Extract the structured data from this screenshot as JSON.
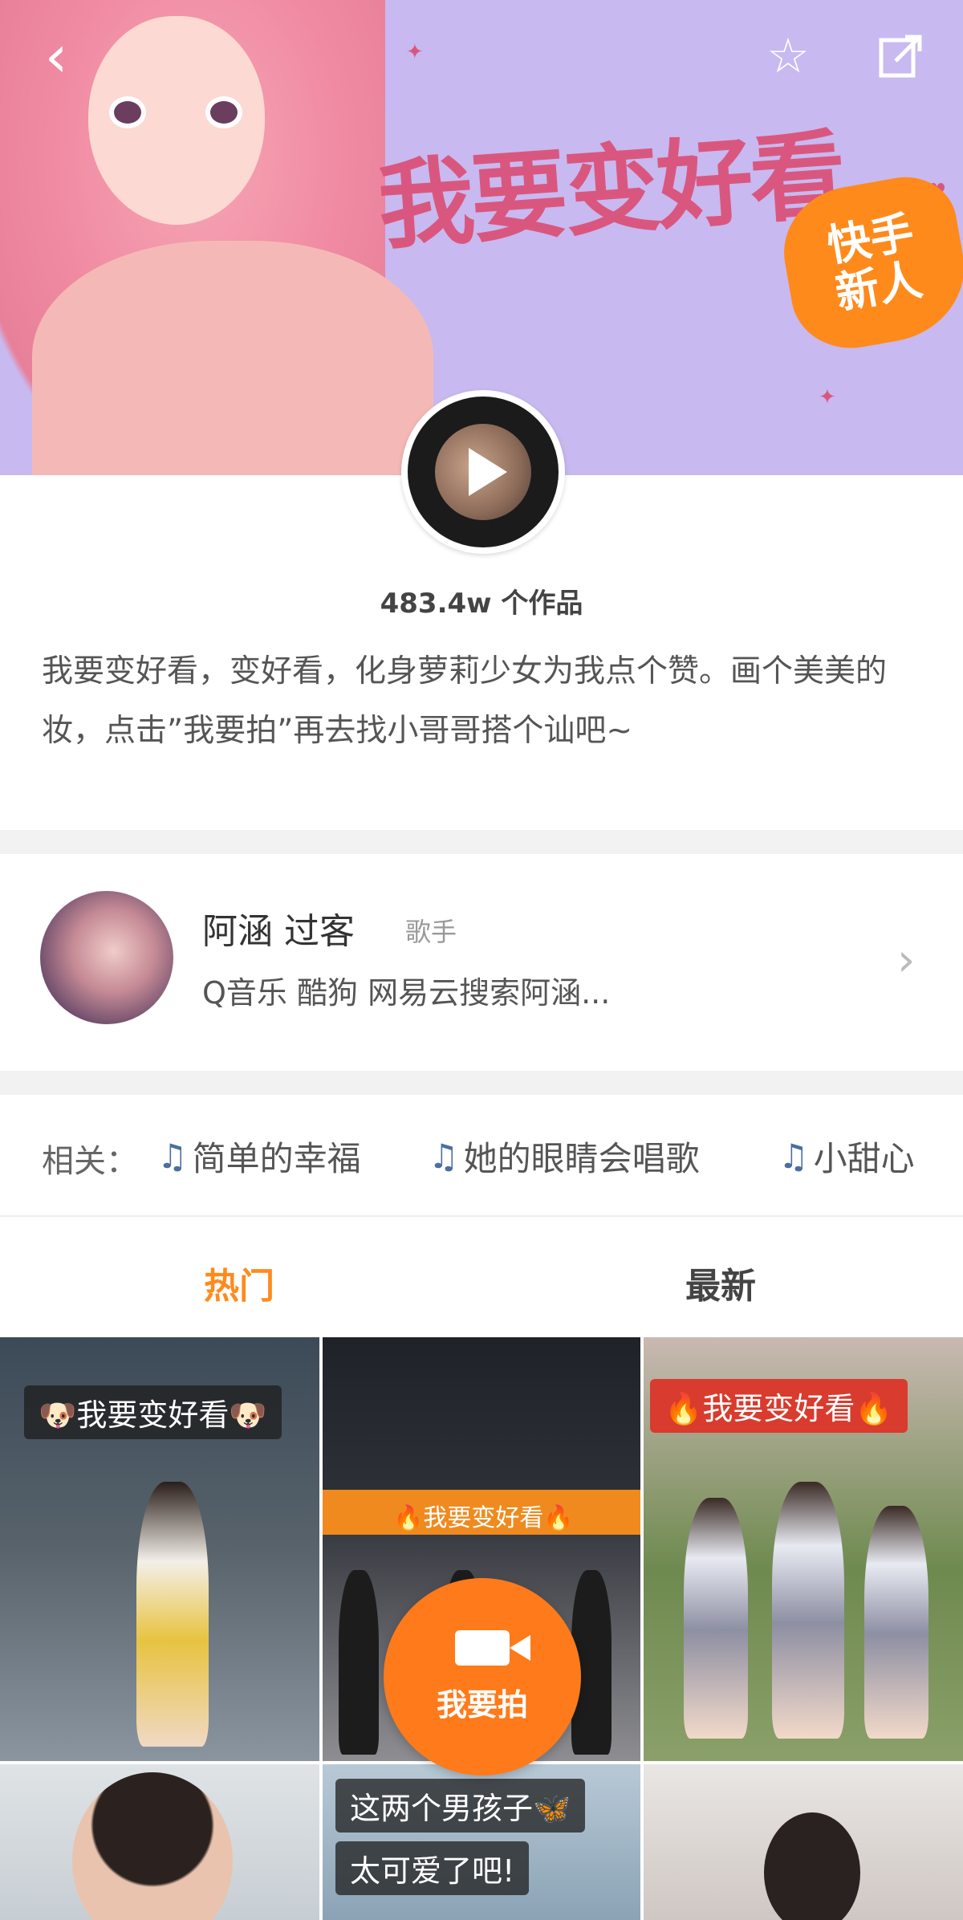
{
  "header": {
    "back_icon": "chevron-left-icon",
    "star_icon": "star-outline-icon",
    "share_icon": "share-icon"
  },
  "banner": {
    "title": "我要变好看",
    "badge_line1": "快手",
    "badge_line2": "新人"
  },
  "topic": {
    "works_count": "483.4w 个作品",
    "description": "我要变好看，变好看，化身萝莉少女为我点个赞。画个美美的妆，点击”我要拍”再去找小哥哥搭个讪吧~"
  },
  "author": {
    "name": "阿涵 过客",
    "role": "歌手",
    "bio": "Q音乐 酷狗 网易云搜索阿涵..."
  },
  "related": {
    "label": "相关：",
    "items": [
      "简单的幸福",
      "她的眼睛会唱歌",
      "小甜心"
    ]
  },
  "tabs": {
    "hot": "热门",
    "latest": "最新"
  },
  "grid": {
    "items": [
      {
        "label": "🐶我要变好看🐶"
      },
      {
        "label": "🔥我要变好看🔥"
      },
      {
        "label": "🔥我要变好看🔥"
      },
      {
        "label": ""
      },
      {
        "label": "这两个男孩子🦋"
      },
      {
        "label": "太可爱了吧!"
      },
      {
        "label": ""
      }
    ]
  },
  "shoot_button": {
    "label": "我要拍"
  },
  "colors": {
    "accent": "#ff8a1c",
    "banner_bg": "#c8b9f0",
    "title_pink": "#d9577f"
  }
}
